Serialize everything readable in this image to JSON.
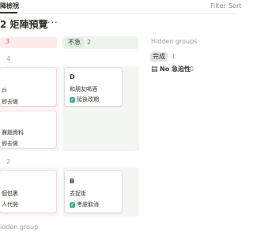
{
  "toolbar": {
    "view_tab": "陣檢視",
    "filter_label": "Filter",
    "sort_label": "Sort"
  },
  "page": {
    "title": "2 矩陣預覽",
    "more_label": "···"
  },
  "columns": [
    {
      "count": "3",
      "color": "#e0626a"
    },
    {
      "tag": "不急",
      "count": "2",
      "color": "#448361"
    }
  ],
  "groups": [
    {
      "count": "4",
      "cards": [
        {
          "title": "",
          "lines": [
            "戶",
            "即去做"
          ]
        },
        {
          "title": "D",
          "lines": [
            "和朋友喝酒"
          ],
          "check": "延後改期"
        },
        {
          "title": "",
          "lines": [
            "賽題資料",
            "即去做"
          ]
        }
      ]
    },
    {
      "count": "2",
      "cards": [
        {
          "title": "",
          "lines": [
            "個包裹",
            "人代勞"
          ]
        },
        {
          "title": "B",
          "lines": [
            "去捉街"
          ],
          "check": "考慮取消"
        }
      ]
    }
  ],
  "hidden_groups": {
    "label": "Hidden groups",
    "items": [
      {
        "tag": "完成",
        "count": "1"
      },
      {
        "label": "No 急迫性",
        "count": "0"
      }
    ]
  },
  "bottom": {
    "hidden_group_label": "idden group"
  },
  "colors": {
    "red_column": "#fdf5f5",
    "green_column": "#f3f6f2",
    "checkbox": "#4dab9a"
  }
}
